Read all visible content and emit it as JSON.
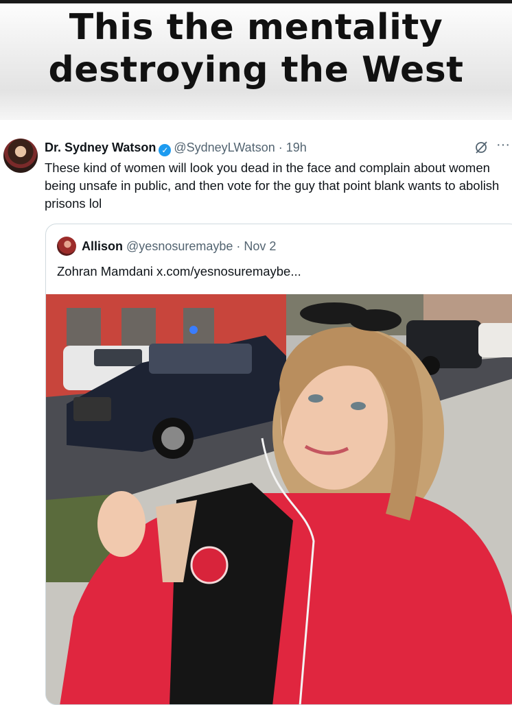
{
  "caption": {
    "line1": "This the mentality",
    "line2": "destroying the West"
  },
  "tweet": {
    "author_name": "Dr. Sydney Watson",
    "handle": "@SydneyLWatson",
    "separator": "·",
    "time": "19h",
    "text": "These kind of women will look you dead in the face and complain about women being unsafe in public, and then vote for the guy that point blank wants to abolish prisons lol",
    "icons": [
      "verified-icon",
      "grok-icon",
      "more-icon"
    ]
  },
  "quote": {
    "author_name": "Allison",
    "handle": "@yesnosuremaybe",
    "separator": "·",
    "date": "Nov 2",
    "text": "Zohran Mamdani",
    "link": "x.com/yesnosuremaybe...",
    "image": "selfie of a woman in a red jacket on a city sidewalk with parked cars"
  },
  "colors": {
    "verified": "#1d9bf0",
    "secondary_text": "#536471",
    "jacket_red": "#e0263f"
  }
}
